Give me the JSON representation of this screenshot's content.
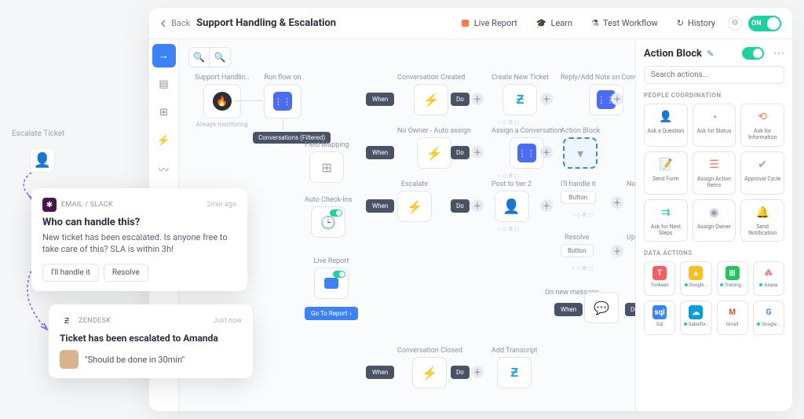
{
  "header": {
    "back": "Back",
    "title": "Support Handling & Escalation",
    "live_report": "Live Report",
    "learn": "Learn",
    "test": "Test Workflow",
    "history": "History",
    "on": "ON"
  },
  "flow": {
    "zoom_in": "+",
    "zoom_out": "−",
    "trigger_label": "Support Handlin..",
    "trigger_sub": "Always monitoring",
    "runflow_label": "Run flow on",
    "conversations_chip": "Conversations (Filtered)",
    "field_mapping": "Field Mapping",
    "auto_checkins": "Auto Check-Ins",
    "live_report_label": "Live Report",
    "go_report": "Go To Report",
    "when": "When",
    "do": "Do",
    "conv_created": "Conversation Created",
    "no_owner": "No Owner - Auto assign",
    "escalate": "Escalate",
    "conv_closed": "Conversation Closed",
    "create_ticket": "Create New Ticket",
    "assign_conv": "Assign a Conversation",
    "post_tier2": "Post to tier 2",
    "add_transcript": "Add Transcript",
    "reply_note": "Reply/Add Note on Convers..",
    "action_block": "Action Block",
    "ill_handle": "I'll handle it",
    "resolve": "Resolve",
    "button": "Button",
    "notify": "Notify",
    "update": "Update",
    "on_new_msg": "On new message"
  },
  "side": {
    "title": "Action Block",
    "search_placeholder": "Search actions...",
    "people_section": "PEOPLE COORDINATION",
    "people": [
      "Ask a Question",
      "Ask for Status",
      "Ask for Information",
      "Send Form",
      "Assign Action Items",
      "Approval Cycle",
      "Ask for Next Steps",
      "Assign Owner",
      "Send Notification"
    ],
    "data_section": "DATA ACTIONS",
    "data": [
      "Tonkean",
      "Google ..",
      "Training ..",
      "Asana",
      "Sql",
      "Salesfor..",
      "Gmail",
      "Google .."
    ]
  },
  "escalate_tag": "Escalate Ticket",
  "notif1": {
    "source": "EMAIL / SLACK",
    "time": "2min ago",
    "question": "Who can handle this?",
    "body": "New ticket has been escalated. Is anyone free to take care of this? SLA is within 3h!",
    "btn1": "I'll handle it",
    "btn2": "Resolve"
  },
  "notif2": {
    "source": "ZENDESK",
    "time": "Just now",
    "title": "Ticket has been escalated to Amanda",
    "quote": "\"Should be done in 30min\""
  }
}
